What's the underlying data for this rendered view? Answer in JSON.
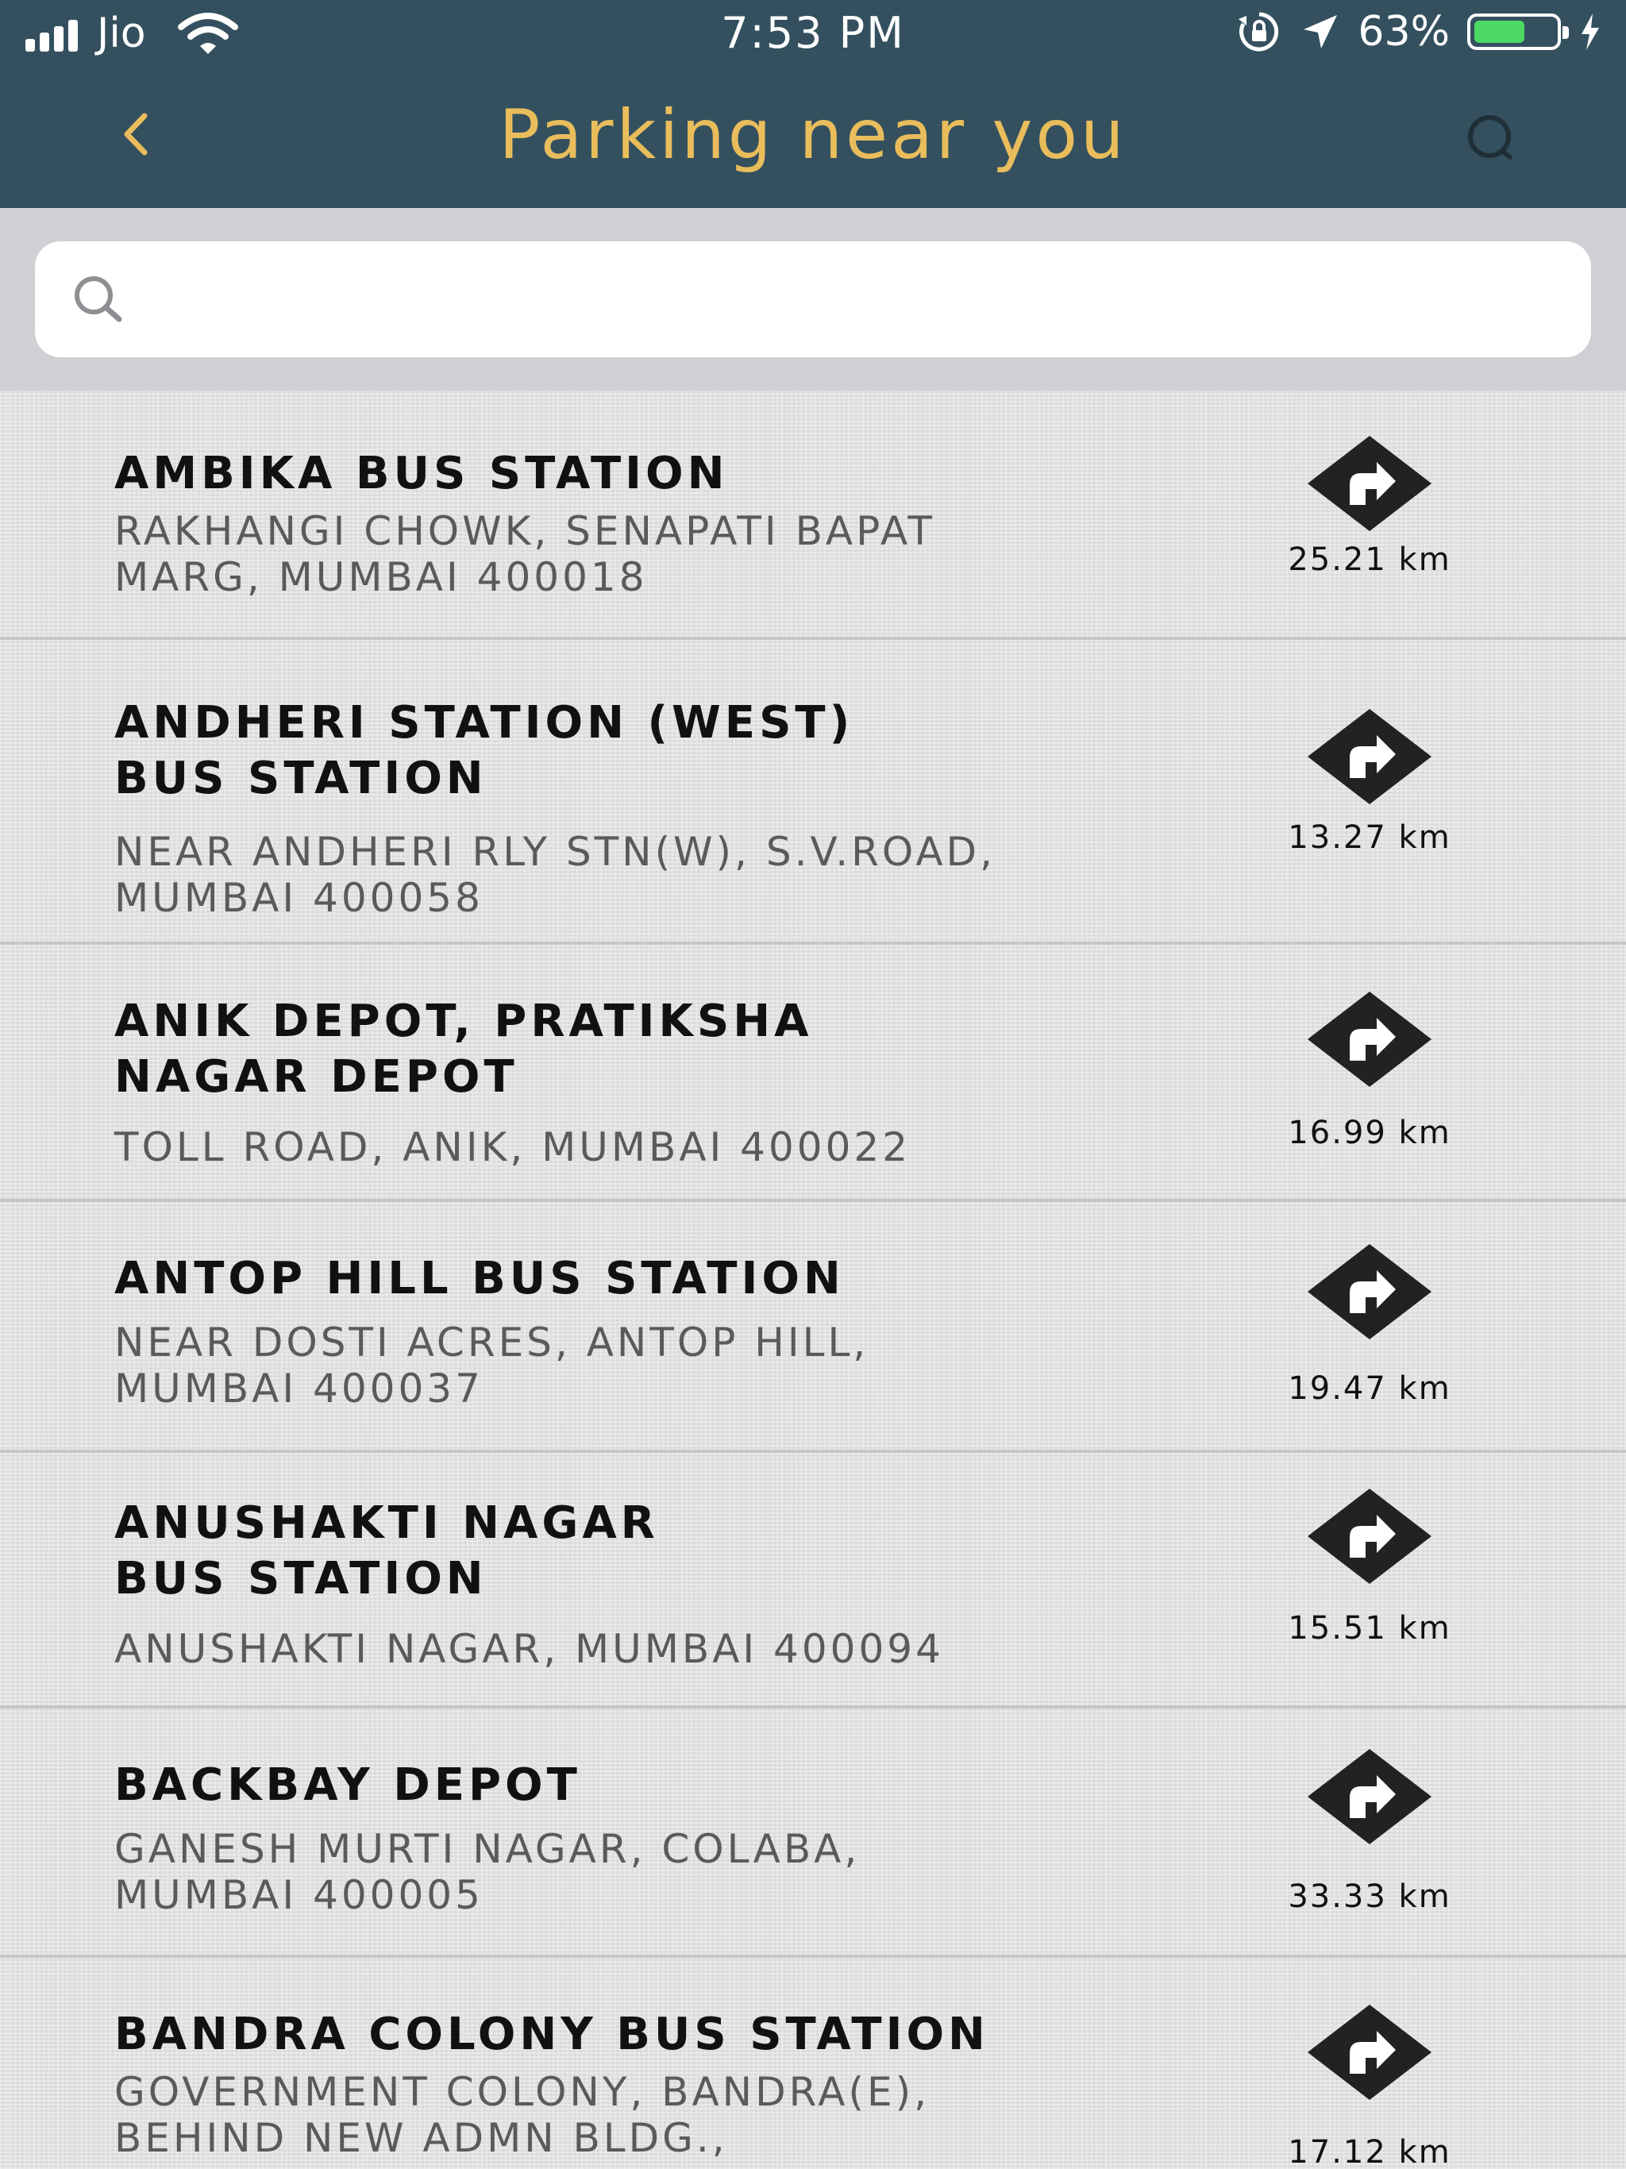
{
  "status_bar": {
    "carrier": "Jio",
    "time": "7:53 PM",
    "battery": "63%",
    "battery_level": 0.63,
    "icons": [
      "signal-icon",
      "wifi-icon",
      "orientation-lock-icon",
      "location-arrow-icon",
      "battery-icon",
      "charging-bolt-icon"
    ]
  },
  "nav": {
    "title": "Parking near you",
    "back_icon": "chevron-left-icon",
    "search_icon": "search-icon",
    "title_color": "#e9bd5b",
    "bar_color": "#34505f"
  },
  "search": {
    "value": "",
    "placeholder": ""
  },
  "stations": [
    {
      "name": "AMBIKA BUS STATION",
      "address": "RAKHANGI CHOWK, SENAPATI BAPAT\nMARG, MUMBAI 400018",
      "distance": "25.21 km"
    },
    {
      "name": "ANDHERI STATION (WEST)\nBUS STATION",
      "address": "NEAR ANDHERI RLY STN(W), S.V.ROAD,\nMUMBAI 400058",
      "distance": "13.27 km"
    },
    {
      "name": "ANIK DEPOT, PRATIKSHA\nNAGAR DEPOT",
      "address": "TOLL ROAD, ANIK, MUMBAI 400022",
      "distance": "16.99 km"
    },
    {
      "name": "ANTOP HILL BUS STATION",
      "address": "NEAR DOSTI ACRES, ANTOP HILL,\nMUMBAI 400037",
      "distance": "19.47 km"
    },
    {
      "name": "ANUSHAKTI NAGAR\nBUS STATION",
      "address": "ANUSHAKTI NAGAR, MUMBAI 400094",
      "distance": "15.51 km"
    },
    {
      "name": "BACKBAY DEPOT",
      "address": "GANESH MURTI NAGAR, COLABA,\nMUMBAI 400005",
      "distance": "33.33 km"
    },
    {
      "name": "BANDRA COLONY BUS STATION",
      "address": "GOVERNMENT COLONY, BANDRA(E),\nBEHIND NEW ADMN BLDG.,",
      "distance": "17.12 km"
    }
  ]
}
